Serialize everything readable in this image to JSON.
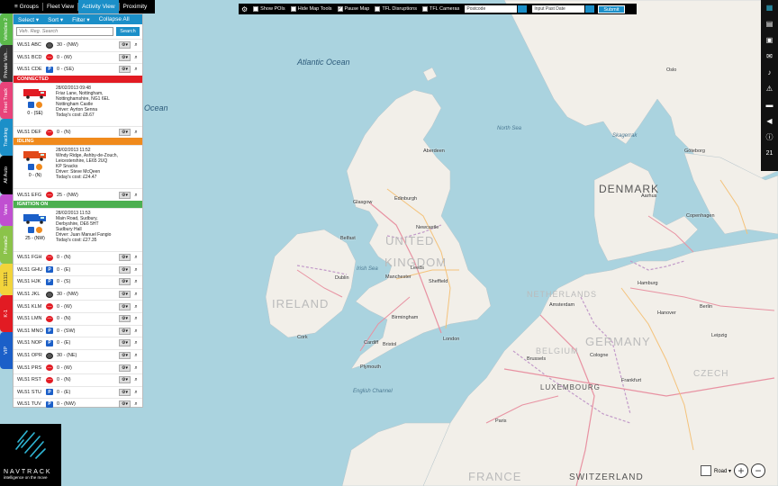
{
  "tabs": {
    "groups": "Groups",
    "fleet_view": "Fleet View",
    "activity_view": "Activity View",
    "proximity": "Proximity"
  },
  "menu": {
    "select": "Select",
    "sort": "Sort",
    "filter": "Filter",
    "collapse_all": "Collapse All"
  },
  "search": {
    "placeholder": "Veh. Reg. Search",
    "button": "Search"
  },
  "side_tabs": [
    "Vehicles 2",
    "Private Veh...",
    "Fleet Track",
    "Tracking",
    "All Auto",
    "Vans",
    "Private2",
    "111111",
    "K-1",
    "VIP"
  ],
  "vehicles_top": [
    {
      "reg": "WL51 ABC",
      "status": "idle",
      "dir": "30 - (NW)"
    },
    {
      "reg": "WL51 BCD",
      "status": "stop",
      "dir": "0 - (W)"
    },
    {
      "reg": "WL51 CDE",
      "status": "park",
      "dir": "0 - (SE)"
    }
  ],
  "connected": {
    "band": "CONNECTED",
    "band_color": "#e21b23",
    "speed_dir": "0 - (SE)",
    "lines": [
      "28/02/2013 09:48",
      "Friar Lane, Nottingham,",
      "Nottinghamshire, NG1 6EL",
      "Nottingham Castle",
      "Driver: Ayrton Senna",
      "Today's cost: £8.67"
    ],
    "reg": "WL51 DEF",
    "row_dir": "0 - (N)"
  },
  "idling": {
    "band": "IDLING",
    "band_color": "#f08a1c",
    "speed_dir": "0 - (N)",
    "lines": [
      "28/02/2013 11:52",
      "Windy Ridge, Ashby-de-Zouch,",
      "Leicestershire, LE65 2UQ",
      "KP Snacks",
      "Driver: Steve McQeen",
      "Today's cost: £24.47"
    ],
    "reg": "WL51 EFG",
    "row_dir": "25 - (NW)"
  },
  "ignition": {
    "band": "IGNITION ON",
    "band_color": "#4caf50",
    "speed_dir": "25 - (NW)",
    "lines": [
      "28/02/2013 11:53",
      "Main Road, Sudbury,",
      "Derbyshire, DE6 5HT",
      "Sudbury Hall",
      "Driver: Juan Manuel Fangio",
      "Today's cost: £27.35"
    ]
  },
  "vehicles_bottom": [
    {
      "reg": "WL51 FGH",
      "status": "stop",
      "dir": "0 - (N)"
    },
    {
      "reg": "WL51 GHU",
      "status": "park",
      "dir": "0 - (E)"
    },
    {
      "reg": "WL51 HJK",
      "status": "park",
      "dir": "0 - (S)"
    },
    {
      "reg": "WL51 JKL",
      "status": "idle",
      "dir": "30 - (NW)"
    },
    {
      "reg": "WL51 KLM",
      "status": "stop",
      "dir": "0 - (W)"
    },
    {
      "reg": "WL51 LMN",
      "status": "stop",
      "dir": "0 - (N)"
    },
    {
      "reg": "WL51 MNO",
      "status": "park",
      "dir": "0 - (SW)"
    },
    {
      "reg": "WL51 NOP",
      "status": "park",
      "dir": "0 - (E)"
    },
    {
      "reg": "WL51 OPR",
      "status": "idle",
      "dir": "30 - (NE)"
    },
    {
      "reg": "WL51 PRS",
      "status": "stop",
      "dir": "0 - (W)"
    },
    {
      "reg": "WL51 RST",
      "status": "stop",
      "dir": "0 - (N)"
    },
    {
      "reg": "WL51 STU",
      "status": "park",
      "dir": "0 - (E)"
    },
    {
      "reg": "WL51 TUV",
      "status": "park",
      "dir": "0 - (NW)"
    }
  ],
  "toolbar": {
    "show_pois": "Show POIs",
    "hide_map_tools": "Hide Map Tools",
    "pause_map": "Pause Map",
    "tfl_disruptions": "TFL Disruptions",
    "tfl_cameras": "TFL Cameras",
    "postcode_placeholder": "Postcode",
    "date_placeholder": "Input Past Date",
    "submit": "Submit"
  },
  "logo": {
    "name": "NAVTRACK",
    "tagline": "intelligence on the move"
  },
  "right_badge": "21",
  "map": {
    "atlantic": "Atlantic Ocean",
    "ocean": "Ocean",
    "north_sea": "North Sea",
    "skagerrak": "Skagerrak",
    "irish_sea": "Irish Sea",
    "english_channel": "English Channel",
    "denmark": "DENMARK",
    "uk1": "UNITED",
    "uk2": "KINGDOM",
    "ireland": "IRELAND",
    "netherlands": "NETHERLANDS",
    "belgium": "BELGIUM",
    "luxembourg": "LUXEMBOURG",
    "switzerland": "SWITZERLAND",
    "germany": "GERMANY",
    "czech": "CZECH",
    "france": "FRANCE",
    "cities": {
      "glasgow": "Glasgow",
      "edinburgh": "Edinburgh",
      "belfast": "Belfast",
      "dublin": "Dublin",
      "manchester": "Manchester",
      "leeds": "Leeds",
      "sheffield": "Sheffield",
      "birmingham": "Birmingham",
      "london": "London",
      "bristol": "Bristol",
      "cardiff": "Cardiff",
      "plymouth": "Plymouth",
      "amsterdam": "Amsterdam",
      "brussels": "Brussels",
      "paris": "Paris",
      "hamburg": "Hamburg",
      "berlin": "Berlin",
      "copenhagen": "Copenhagen",
      "aarhus": "Aarhus",
      "oslo": "Oslo",
      "gothenburg": "Göteborg",
      "cork": "Cork",
      "hanover": "Hanover",
      "cologne": "Cologne",
      "frankfurt": "Frankfurt",
      "newcastle": "Newcastle",
      "aberdeen": "Aberdeen",
      "leipzig": "Leipzig"
    },
    "layer": "Road"
  }
}
